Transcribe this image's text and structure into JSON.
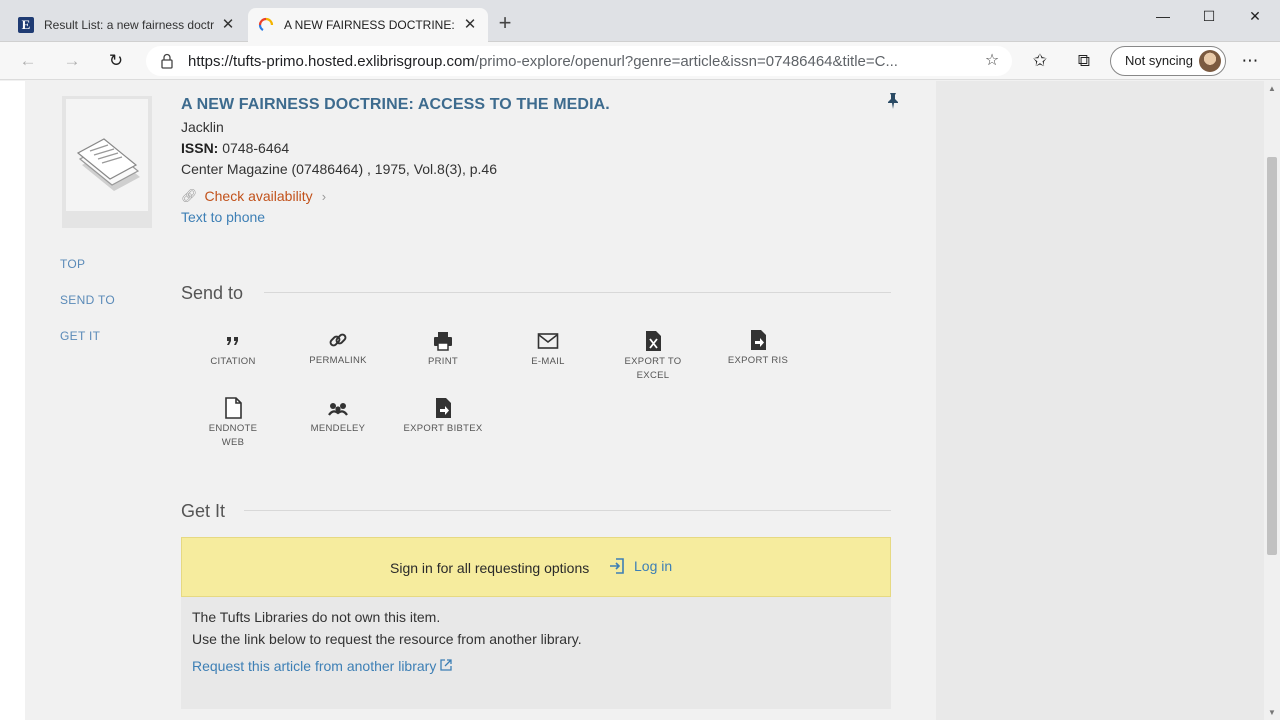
{
  "browser": {
    "tabs": [
      {
        "title": "Result List: a new fairness doctrin",
        "favicon": "E",
        "active": false
      },
      {
        "title": "A NEW FAIRNESS DOCTRINE: AC",
        "favicon": "primo-logo",
        "active": true
      }
    ],
    "url_host": "https://tufts-primo.hosted.exlibrisgroup.com",
    "url_path": "/primo-explore/openurl?genre=article&issn=07486464&title=C...",
    "profile_label": "Not syncing"
  },
  "record": {
    "title": "A NEW FAIRNESS DOCTRINE: ACCESS TO THE MEDIA.",
    "author": "Jacklin",
    "issn_label": "ISSN:",
    "issn_value": "0748-6464",
    "source": "Center Magazine (07486464) , 1975, Vol.8(3), p.46",
    "check_availability": "Check availability",
    "text_to_phone": "Text to phone"
  },
  "sidenav": {
    "items": [
      "TOP",
      "SEND TO",
      "GET IT"
    ]
  },
  "send_to": {
    "title": "Send to",
    "actions": [
      {
        "label": "CITATION",
        "icon": "quote-icon"
      },
      {
        "label": "PERMALINK",
        "icon": "link-icon"
      },
      {
        "label": "PRINT",
        "icon": "printer-icon"
      },
      {
        "label": "E-MAIL",
        "icon": "envelope-icon"
      },
      {
        "label_line1": "EXPORT TO",
        "label_line2": "EXCEL",
        "icon": "excel-file-icon"
      },
      {
        "label": "EXPORT RIS",
        "icon": "export-file-icon"
      },
      {
        "label_line1": "ENDNOTE",
        "label_line2": "WEB",
        "icon": "document-icon"
      },
      {
        "label": "MENDELEY",
        "icon": "mendeley-icon"
      },
      {
        "label": "EXPORT BIBTEX",
        "icon": "export-file-icon"
      }
    ]
  },
  "get_it": {
    "title": "Get It",
    "sign_in_text": "Sign in for all requesting options",
    "login_label": "Log in",
    "not_owned": "The Tufts Libraries do not own this item.",
    "use_link": "Use the link below to request the resource from another library.",
    "request_link": "Request this article from another library"
  },
  "colors": {
    "title_blue": "#3d6b8e",
    "link_blue": "#3d7fb5",
    "availability_orange": "#c2521b",
    "login_yellow": "#f6ec9e"
  }
}
